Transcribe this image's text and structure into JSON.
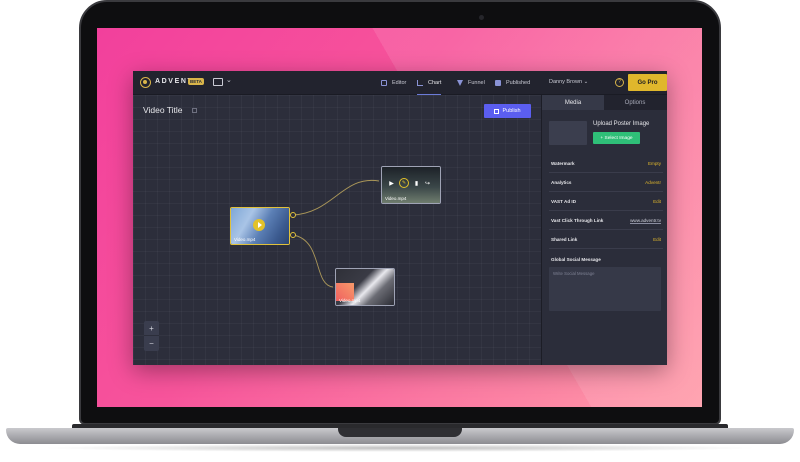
{
  "app": {
    "logo_text": "ADVENTR",
    "beta_badge": "BETA",
    "nav": {
      "editor": "Editor",
      "chart": "Chart",
      "funnel": "Funnel",
      "published": "Published"
    },
    "user_name": "Danny Brown",
    "user_chevron": "⌄",
    "help": "?",
    "go_pro": "Go Pro",
    "device_chevron": "⌄"
  },
  "canvas": {
    "title": "Video Title",
    "publish_label": "Publish",
    "nodes": [
      {
        "label": "Video.mp4"
      },
      {
        "label": "Video.mp4"
      },
      {
        "label": "Video.mp4"
      }
    ],
    "zoom_in": "+",
    "zoom_out": "−"
  },
  "panel": {
    "tabs": [
      "Media",
      "Options"
    ],
    "poster_title": "Upload Poster Image",
    "select_image": "+ Select Image",
    "rows": [
      {
        "label": "Watermark",
        "value": "Empty"
      },
      {
        "label": "Analytics",
        "value": "Adventr"
      },
      {
        "label": "VAST Ad ID",
        "value": "Edit"
      },
      {
        "label": "Vast Click Through Link",
        "value": "www.adventr.tv"
      },
      {
        "label": "Shared Link",
        "value": "Edit"
      }
    ],
    "social_label": "Global Social Message",
    "social_placeholder": "Write Social Message"
  },
  "colors": {
    "accent_gold": "#e0b72c",
    "publish_purple": "#5b5ef0",
    "select_green": "#2fbf78",
    "app_bg": "#2b2d3a"
  }
}
